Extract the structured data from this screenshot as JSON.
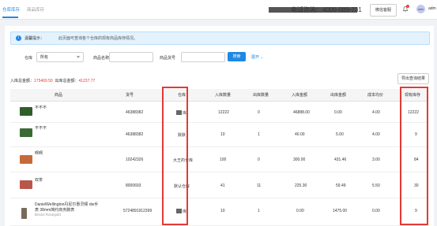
{
  "tabs": [
    {
      "label": "仓库库存",
      "active": true
    },
    {
      "label": "商品库存",
      "active": false
    }
  ],
  "header": {
    "phone": "电话咨询：4006-089-731",
    "wechat_label": "微信客服",
    "avatar_text": "adm",
    "user": "adm"
  },
  "notice": {
    "title": "温馨提示：",
    "text": "此页面可查询各个仓库的现有商品库存情况。"
  },
  "filters": {
    "warehouse_label": "仓库",
    "warehouse_value": "所有",
    "name_label": "商品名称",
    "name_value": "",
    "code_label": "商品货号",
    "code_value": "",
    "search_label": "搜索",
    "expand_label": "展开"
  },
  "stats": {
    "in_label": "入库总金额：",
    "in_value": "175469.50",
    "out_label": "出库总金额：",
    "out_value": "41237.77"
  },
  "export_label": "导出查询结果",
  "columns": [
    "商品",
    "货号",
    "仓库",
    "入库数量",
    "出库数量",
    "入库金额",
    "出库金额",
    "成本均价",
    "现有库存"
  ],
  "rows": [
    {
      "name": "不不不",
      "name2": "",
      "sku": "46388382",
      "warehouse": "库",
      "in_qty": "12222",
      "out_qty": "0",
      "in_amt": "46888.00",
      "out_amt": "0.00",
      "avg": "4.00",
      "stock": "12222"
    },
    {
      "name": "不不不",
      "name2": "",
      "sku": "46388382",
      "warehouse": "默默",
      "in_qty": "10",
      "out_qty": "1",
      "in_amt": "40.00",
      "out_amt": "5.00",
      "avg": "4.00",
      "stock": "9"
    },
    {
      "name": "啊啊",
      "name2": "",
      "sku": "10242326",
      "warehouse": "大王的仓库",
      "in_qty": "100",
      "out_qty": "0",
      "in_amt": "300.00",
      "out_amt": "431.46",
      "avg": "3.00",
      "stock": "84"
    },
    {
      "name": "双茶",
      "name2": "",
      "sku": "8000693",
      "warehouse": "默认仓库",
      "in_qty": "41",
      "out_qty": "11",
      "in_amt": "225.30",
      "out_amt": "59.49",
      "avg": "5.50",
      "stock": "30"
    },
    {
      "name": "DanielWellington丹尼尔惠灵顿 dw手",
      "name2": "表 38mm简约商务腕表",
      "name3": "Bristol Rosegold",
      "sku": "5724891912399",
      "warehouse": "库",
      "in_qty": "10",
      "out_qty": "1",
      "in_amt": "0.00",
      "out_amt": "1475.00",
      "avg": "0.00",
      "stock": "9"
    }
  ]
}
